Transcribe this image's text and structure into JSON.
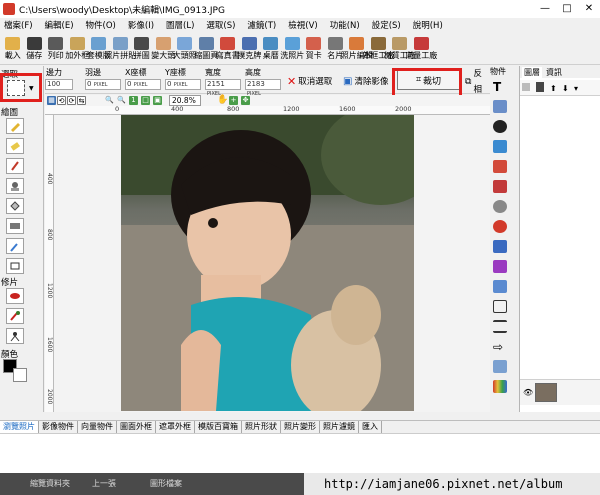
{
  "window": {
    "title": "C:\\Users\\woody\\Desktop\\未編輯\\IMG_0913.JPG",
    "controls": [
      "—",
      "□",
      "✕"
    ]
  },
  "menu": [
    "檔案(F)",
    "編輯(E)",
    "物件(O)",
    "影像(I)",
    "圖層(L)",
    "選取(S)",
    "濾鏡(T)",
    "檢視(V)",
    "功能(N)",
    "設定(S)",
    "說明(H)"
  ],
  "toolbar": [
    {
      "label": "載入",
      "icon": "folder-icon",
      "color": "#e2b04a"
    },
    {
      "label": "儲存",
      "icon": "disk-icon",
      "color": "#3a3a3a"
    },
    {
      "label": "列印",
      "icon": "printer-icon",
      "color": "#5a5a5a"
    },
    {
      "label": "加外框",
      "icon": "frame-icon",
      "color": "#c9a45a"
    },
    {
      "label": "套模版",
      "icon": "template-icon",
      "color": "#6aa0d0"
    },
    {
      "label": "照片拼貼",
      "icon": "collage-icon",
      "color": "#7aa0c8"
    },
    {
      "label": "拼圖",
      "icon": "puzzle-icon",
      "color": "#4a4a4a"
    },
    {
      "label": "變大頭",
      "icon": "bighead-icon",
      "color": "#d7a070"
    },
    {
      "label": "大頭照",
      "icon": "idphoto-icon",
      "color": "#7aa6d8"
    },
    {
      "label": "縮圖頁",
      "icon": "thumbs-icon",
      "color": "#5f7fa8"
    },
    {
      "label": "寫真書",
      "icon": "book-icon",
      "color": "#d14a3c"
    },
    {
      "label": "撲克牌",
      "icon": "cards-icon",
      "color": "#4c6fb0"
    },
    {
      "label": "桌曆",
      "icon": "calendar-icon",
      "color": "#4a8dc2"
    },
    {
      "label": "洗照片",
      "icon": "print-photo-icon",
      "color": "#5aa0d8"
    },
    {
      "label": "賀卡",
      "icon": "card-icon",
      "color": "#d4604c"
    },
    {
      "label": "名片",
      "icon": "namecard-icon",
      "color": "#777777"
    },
    {
      "label": "照片編輯",
      "icon": "edit-icon",
      "color": "#d97a3a"
    },
    {
      "label": "外框工廠",
      "icon": "frame-factory-icon",
      "color": "#8a6a3a"
    },
    {
      "label": "材質工廠",
      "icon": "texture-icon",
      "color": "#b99a66"
    },
    {
      "label": "向量工廠",
      "icon": "vector-icon",
      "color": "#c63a3a"
    }
  ],
  "left_panel": {
    "select_label": "選取",
    "draw_label": "繪圖",
    "retouch_label": "修片",
    "color_label": "顏色",
    "colors": {
      "foreground": "#000000",
      "background": "#ffffff"
    }
  },
  "options": {
    "labels": [
      "邊力",
      "羽邊",
      "X座標",
      "Y座標",
      "寬度",
      "高度"
    ],
    "values": [
      "100",
      "0",
      "0",
      "0",
      "2151",
      "2183"
    ],
    "unit": "PIXEL",
    "deselect_label": "取消選取",
    "clear_label": "清除影像",
    "crop_label": "裁切",
    "invert_label": "反相"
  },
  "zoom": {
    "value": "20.8%"
  },
  "ruler": {
    "top": [
      "0",
      "400",
      "800",
      "1200",
      "1600",
      "2000"
    ],
    "left": [
      "400",
      "800",
      "1200",
      "1600",
      "2000"
    ]
  },
  "right_panel": {
    "tabs": [
      "物件",
      "圖層",
      "資訊"
    ]
  },
  "bottom_tabs": [
    "瀏覽照片",
    "影像物件",
    "向量物件",
    "圖面外框",
    "遮罩外框",
    "模版百寶箱",
    "照片形狀",
    "照片變形",
    "照片濾鏡",
    "匯入"
  ],
  "taskbar": {
    "items": [
      "縮覽資料夾",
      "上一張",
      "圖形檔案"
    ]
  },
  "watermark": "http://iamjane06.pixnet.net/album"
}
